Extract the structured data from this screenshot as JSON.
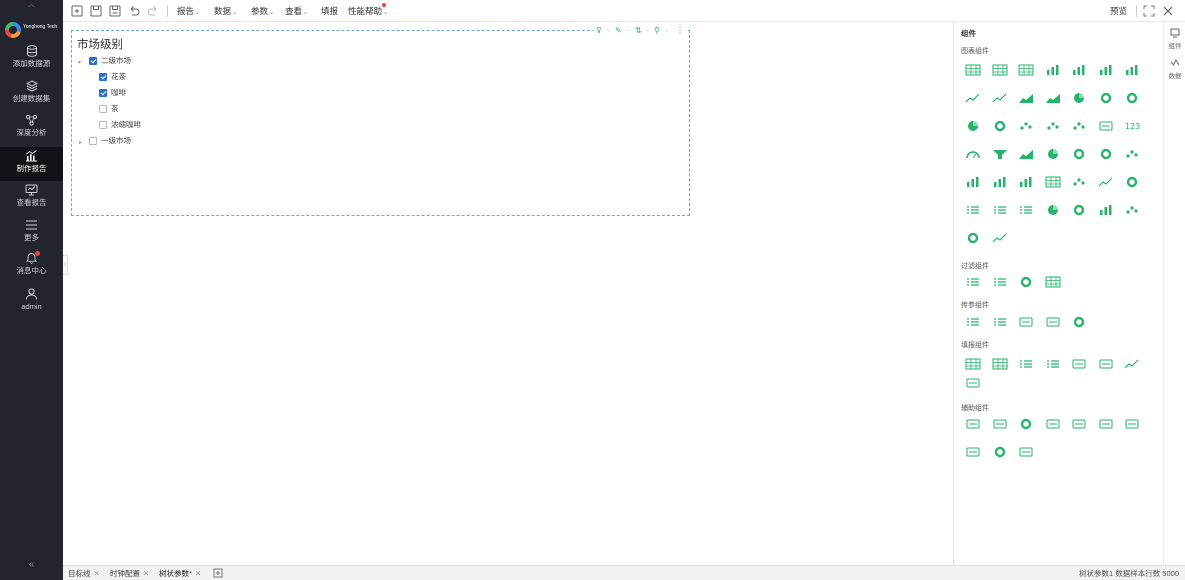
{
  "nav": {
    "items": [
      {
        "label": "添加数据源",
        "icon": "database-icon"
      },
      {
        "label": "创建数据集",
        "icon": "layers-icon"
      },
      {
        "label": "深度分析",
        "icon": "analysis-icon"
      },
      {
        "label": "制作报告",
        "icon": "chart-report-icon",
        "active": true
      },
      {
        "label": "查看报告",
        "icon": "monitor-icon"
      },
      {
        "label": "更多",
        "icon": "menu-icon"
      },
      {
        "label": "消息中心",
        "icon": "bell-icon"
      },
      {
        "label": "admin",
        "icon": "user-icon"
      }
    ],
    "logo_text": "Yonghong Tech",
    "collapse": "«"
  },
  "toolbar": {
    "menus": [
      {
        "label": "报告",
        "chevron": "⌄"
      },
      {
        "label": "数据",
        "chevron": "⌄"
      },
      {
        "label": "参数",
        "chevron": "⌄"
      },
      {
        "label": "查看",
        "chevron": "⌄"
      },
      {
        "label": "填报",
        "chevron": ""
      },
      {
        "label": "性能帮助",
        "chevron": "⌄"
      }
    ],
    "preview": "预览"
  },
  "widget": {
    "title": "市场级别",
    "tree": [
      {
        "label": "二级市场",
        "checked": true,
        "expanded": true
      },
      {
        "label": "花茶",
        "checked": true
      },
      {
        "label": "咖啡",
        "checked": true
      },
      {
        "label": "茶",
        "checked": false
      },
      {
        "label": "浓缩咖啡",
        "checked": false
      },
      {
        "label": "一级市场",
        "checked": false,
        "expanded": false
      }
    ]
  },
  "panel": {
    "title": "组件",
    "sections": [
      "图表组件",
      "过滤组件",
      "传参组件",
      "填报组件",
      "辅助组件"
    ],
    "tabs": [
      "组件",
      "数据"
    ]
  },
  "bottom": {
    "tabs": [
      "目标线",
      "时钟配置",
      "树状参数*"
    ],
    "status": "树状参数1  数据样本行数 5000"
  },
  "colors": {
    "accent": "#27b36a",
    "nav_bg": "#22242e",
    "selection": "#2d6fd1"
  }
}
